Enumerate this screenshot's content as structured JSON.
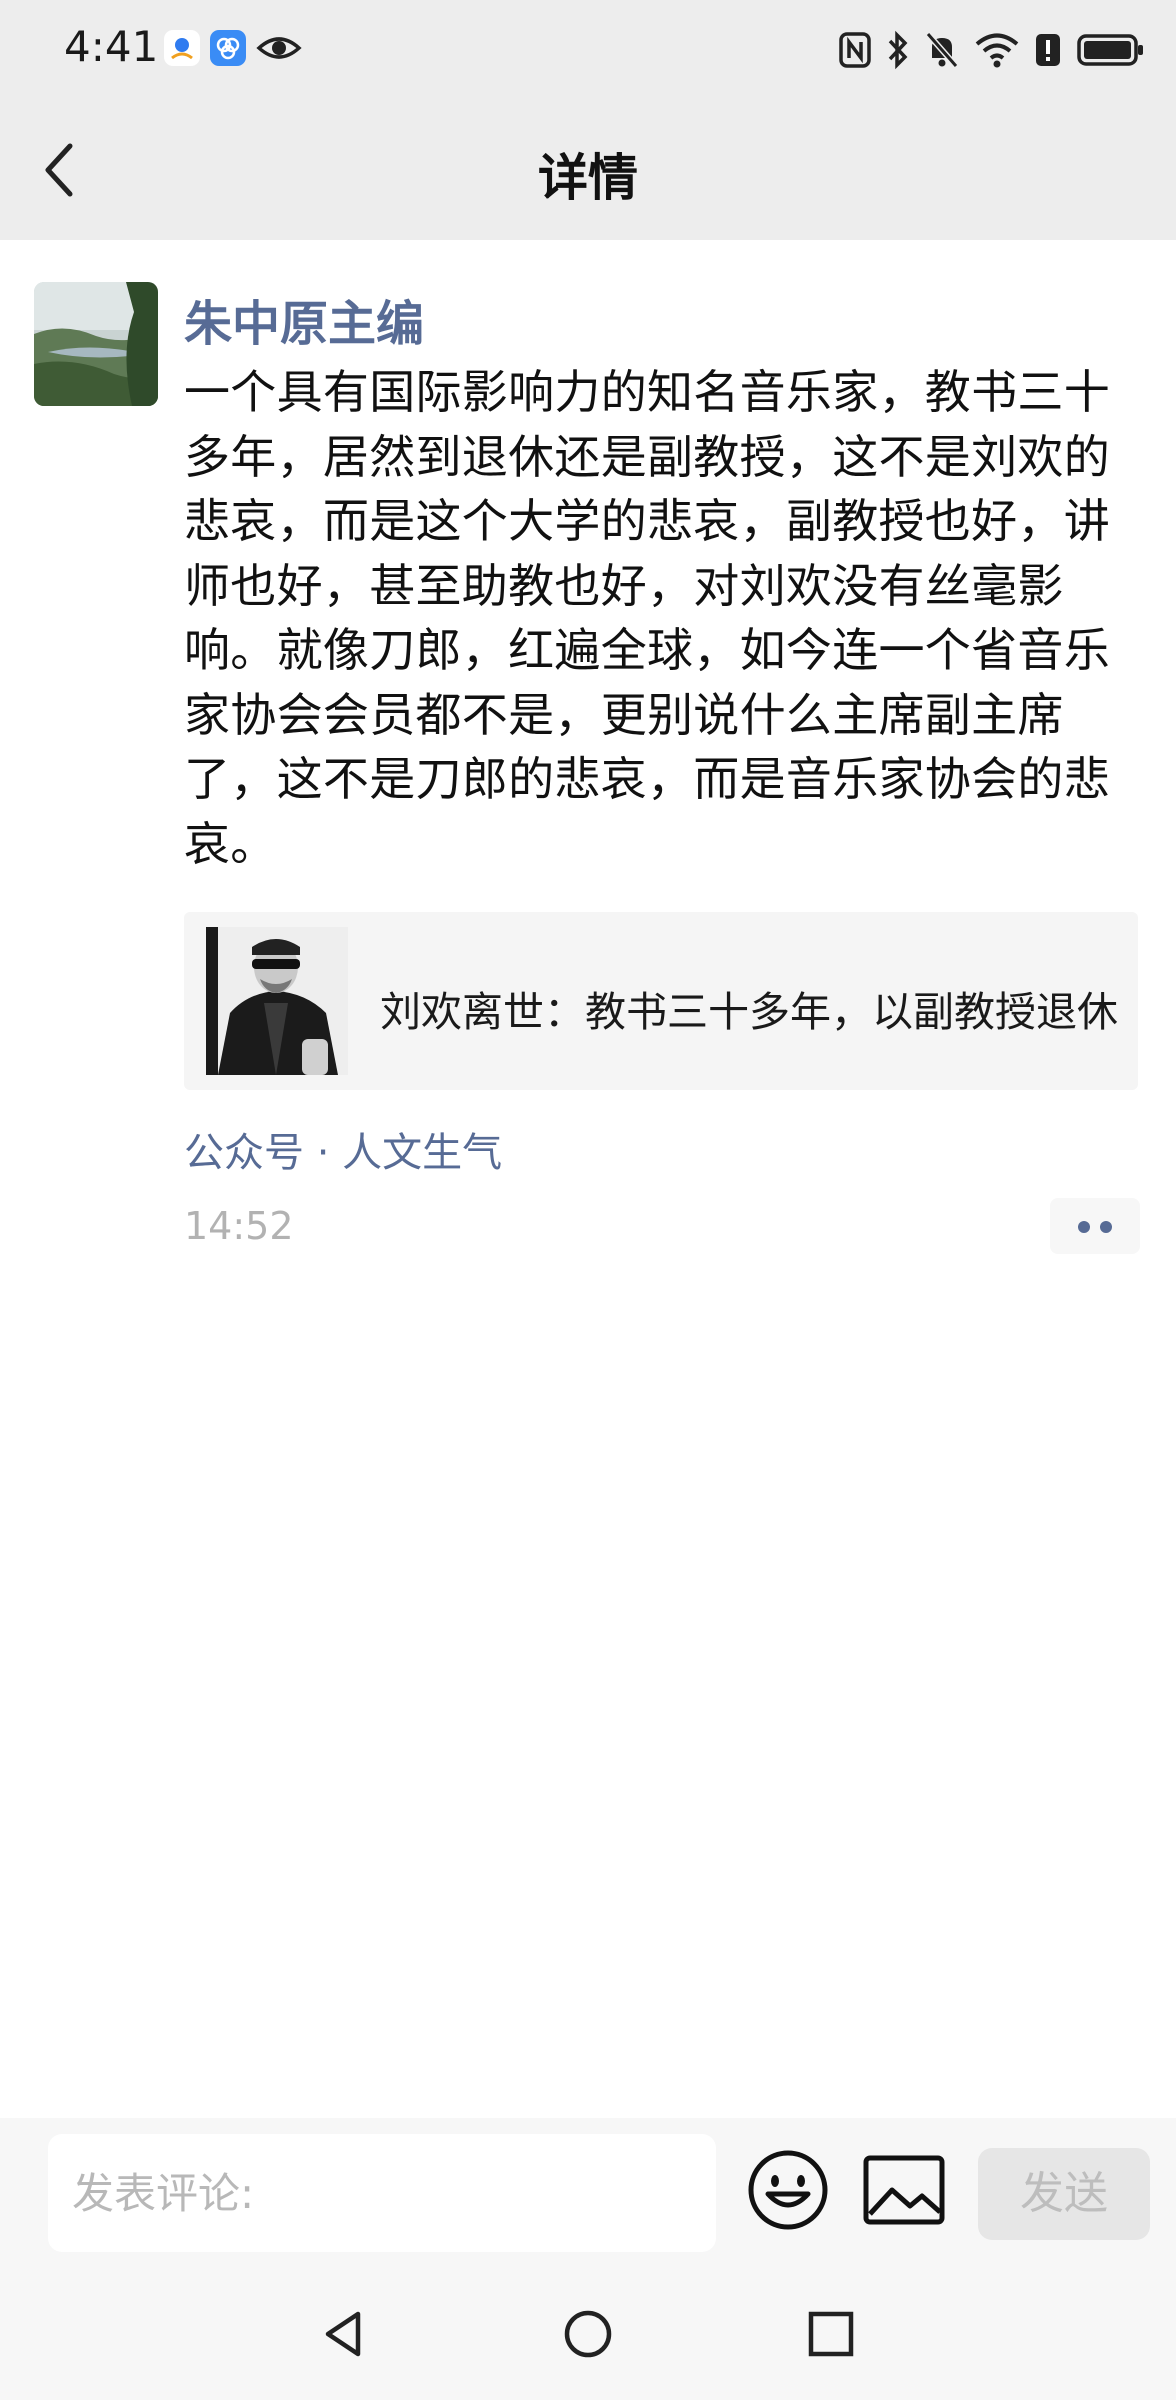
{
  "status_bar": {
    "time": "4:41",
    "left_icons": [
      "location-app-icon",
      "flower-app-icon",
      "eye-icon"
    ],
    "right_icons": [
      "nfc-icon",
      "bluetooth-icon",
      "mute-icon",
      "wifi-icon",
      "alert-icon",
      "battery-icon"
    ]
  },
  "header": {
    "title": "详情",
    "back_icon": "chevron-left-icon"
  },
  "post": {
    "author": "朱中原主编",
    "text": "一个具有国际影响力的知名音乐家，教书三十多年，居然到退休还是副教授，这不是刘欢的悲哀，而是这个大学的悲哀，副教授也好，讲师也好，甚至助教也好，对刘欢没有丝毫影响。就像刀郎，红遍全球，如今连一个省音乐家协会会员都不是，更别说什么主席副主席了，这不是刀郎的悲哀，而是音乐家协会的悲哀。",
    "link_card": {
      "title": "刘欢离世：教书三十多年，以副教授退休"
    },
    "source": "公众号 · 人文生气",
    "time": "14:52",
    "more_icon": "more-dots-icon"
  },
  "comment_bar": {
    "input_placeholder": "发表评论:",
    "input_value": "",
    "emoji_icon": "emoji-icon",
    "image_icon": "image-icon",
    "send_label": "发送"
  },
  "nav_bar": {
    "buttons": [
      "back-triangle-icon",
      "home-circle-icon",
      "recents-square-icon"
    ]
  },
  "colors": {
    "author_blue": "#576b95",
    "header_bg": "#ededed",
    "time_gray": "#b2b2b2"
  }
}
